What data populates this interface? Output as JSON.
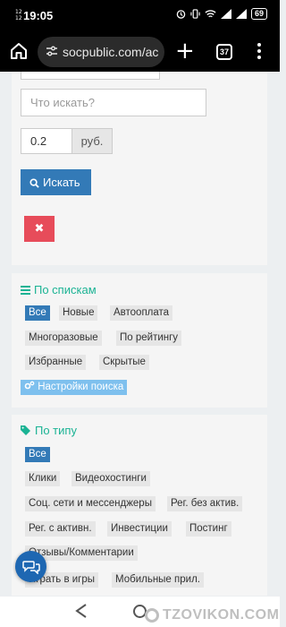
{
  "status_bar": {
    "sim": "12\n12",
    "time": "19:05",
    "battery": "69"
  },
  "browser": {
    "url": "socpublic.com/ac",
    "tab_count": "37"
  },
  "search": {
    "placeholder": "Что искать?",
    "price_value": "0.2",
    "currency": "руб.",
    "search_button": "Искать",
    "clear_button": "✖"
  },
  "lists_section": {
    "title": "По спискам",
    "tags": [
      "Все",
      "Новые",
      "Автооплата",
      "Многоразовые",
      "По рейтингу",
      "Избранные",
      "Скрытые"
    ],
    "settings_button": "Настройки поиска"
  },
  "type_section": {
    "title": "По типу",
    "tags": [
      "Все",
      "Клики",
      "Видеохостинги",
      "Соц. сети и мессенджеры",
      "Рег. без актив.",
      "Рег. с активн.",
      "Инвестиции",
      "Постинг",
      "Отзывы/Комментарии",
      "Играть в игры",
      "Мобильные прил."
    ]
  },
  "watermark": "TZOVIKON.COM",
  "colors": {
    "accent": "#1bb394",
    "primary": "#337ab7",
    "danger": "#e74c5a",
    "info": "#7ec0ee"
  },
  "icons": [
    "home-icon",
    "tune-icon",
    "plus-icon",
    "tabs-icon",
    "overflow-menu-icon",
    "search-icon",
    "bars-icon",
    "cogs-icon",
    "tags-icon",
    "chat-icon",
    "back-icon",
    "nav-home-icon"
  ]
}
